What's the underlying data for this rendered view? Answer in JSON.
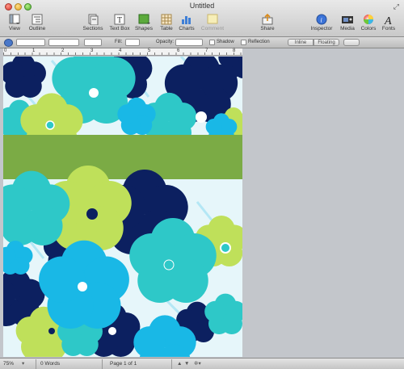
{
  "window": {
    "title": "Untitled"
  },
  "toolbar": {
    "view": "View",
    "outline": "Outline",
    "sections": "Sections",
    "text_box": "Text Box",
    "shapes": "Shapes",
    "table": "Table",
    "charts": "Charts",
    "comment": "Comment",
    "share": "Share",
    "inspector": "Inspector",
    "media": "Media",
    "colors": "Colors",
    "fonts": "Fonts"
  },
  "formatbar": {
    "fill_label": "Fill:",
    "opacity_label": "Opacity:",
    "shadow_label": "Shadow",
    "reflection_label": "Reflection",
    "inline_label": "Inline",
    "floating_label": "Floating"
  },
  "ruler": {
    "marks": [
      "0",
      "1",
      "2",
      "3",
      "4",
      "5",
      "6",
      "7",
      "8"
    ]
  },
  "statusbar": {
    "zoom": "75%",
    "words": "0 Words",
    "page": "Page 1 of 1"
  },
  "colors": {
    "band": "#7bab45",
    "navy": "#0c2060",
    "turquoise": "#2ec8c8",
    "cyan": "#19b8e6",
    "lime": "#bfe05a",
    "pale": "#e6f6fa"
  }
}
